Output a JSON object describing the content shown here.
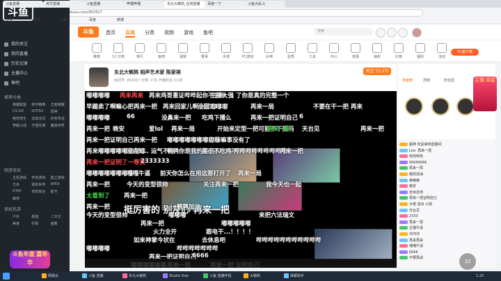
{
  "browser": {
    "tabs": [
      "斗鱼直播",
      "虎牙直播",
      "斗鱼直播",
      "哔哩哔哩",
      "东北大鹌鹑_在线直播",
      "百度一下",
      "斗鱼大乱斗"
    ],
    "url": "https://www.douyu.com/952917",
    "bookmarks": [
      "斗鱼",
      "虎牙",
      "B站",
      "百度",
      "微博"
    ]
  },
  "app": {
    "logo": "斗鱼",
    "nav": [
      "我的关注",
      "我的直播",
      "历史记录",
      "主播中心",
      "鱼吧"
    ],
    "sections": [
      "推荐分类",
      "网游竞技",
      "单机热游"
    ],
    "grid1": [
      "英雄联盟",
      "和平精英",
      "王者荣耀",
      "CS:GO",
      "DOTA2",
      "原神",
      "绝地求生",
      "永劫无间",
      "炉石传说",
      "穿越火线",
      "守望先锋",
      "魔兽世界"
    ],
    "grid2": [
      "主机游戏",
      "怀旧游戏",
      "独立游戏",
      "方舟",
      "我的世界",
      "APEX",
      "GTA5",
      "单机综合",
      "欧卡",
      "森林"
    ],
    "grid3": [
      "户外",
      "颜值",
      "二次元",
      "美食",
      "科技",
      "鱼教"
    ],
    "badge": "斗鱼年度 嘉年华"
  },
  "site": {
    "logo": "斗鱼",
    "nav": [
      "首页",
      "直播",
      "分类",
      "视频",
      "游戏",
      "鱼吧"
    ],
    "search_placeholder": "搜索",
    "cats": [
      "推荐",
      "12 分类",
      "排行",
      "鱼吧",
      "视频",
      "赛事",
      "手游",
      "PC游戏",
      "女神",
      "星秀",
      "工具",
      "中心",
      "竞猜",
      "抽奖",
      "礼物",
      "福利",
      "活动",
      "消息",
      "帮助"
    ],
    "pc_btn": "PC客户端"
  },
  "room": {
    "title": "东北大鹌鹑 相声艺术家 陈家祺",
    "sub": "房间号: 952917    分类: 户外    开播时长 2小时",
    "follow": "关注 72.2万"
  },
  "danmaku": [
    {
      "t": "嘟嘟嘟嘟",
      "c": "white"
    },
    {
      "t": "再来再来",
      "c": "red"
    },
    {
      "t": "再来鸡哥重证哔哔起你不要来",
      "c": "white"
    },
    {
      "t": "主播大强 了你是真的完整一个",
      "c": "white"
    },
    {
      "t": "早踢卖了啊嘛心把",
      "c": "white"
    },
    {
      "t": "再来一把",
      "c": "white"
    },
    {
      "t": "再来回家儿啊小蒙嘟嘟嘟",
      "c": "white"
    },
    {
      "t": "没回2333",
      "c": "white"
    },
    {
      "t": "再来一局",
      "c": "white"
    },
    {
      "t": "不要在干一把 再来",
      "c": "white"
    },
    {
      "t": "嘟嘟嘟嘟",
      "c": "white"
    },
    {
      "t": "66",
      "c": "white"
    },
    {
      "t": "没鼻来一把",
      "c": "white"
    },
    {
      "t": "吃鸡下播么",
      "c": "white"
    },
    {
      "t": "再来一把证明自己",
      "c": "white"
    },
    {
      "t": "6",
      "c": "white"
    },
    {
      "t": "再来一把",
      "c": "white"
    },
    {
      "t": "晚安",
      "c": "white"
    },
    {
      "t": "爱lol",
      "c": "white"
    },
    {
      "t": "再来一局",
      "c": "white"
    },
    {
      "t": "开始来定型一把可能不下播吗",
      "c": "white"
    },
    {
      "t": "再来一把",
      "c": "green"
    },
    {
      "t": "天台见",
      "c": "white"
    },
    {
      "t": "再来一把",
      "c": "white"
    },
    {
      "t": "再来一把证明自己",
      "c": "white"
    },
    {
      "t": "再来一把",
      "c": "white"
    },
    {
      "t": "嘟嘟嘟嘟嘟嘟嘟嘟嘟",
      "c": "white"
    },
    {
      "t": "刀妹嘛事没有了",
      "c": "white"
    },
    {
      "t": "再来嘟嘟嘟嘟嘟嘟嘟嘟",
      "c": "white"
    },
    {
      "t": "没点知.. 运气不好",
      "c": "white"
    },
    {
      "t": "鹌鹑你是我的接班人",
      "c": "white"
    },
    {
      "t": "蒸小不吃鸡不下",
      "c": "white"
    },
    {
      "t": "哔哔哔哔哔哔哔哔哔",
      "c": "white"
    },
    {
      "t": "再来一把",
      "c": "white"
    },
    {
      "t": "再来一把证明了一等奖",
      "c": "red"
    },
    {
      "t": "2333333",
      "c": "white"
    },
    {
      "t": "嘟嘟嘟嘟嘟嘟嘟嘟",
      "c": "white"
    },
    {
      "t": "嘎嘎牛逼",
      "c": "white"
    },
    {
      "t": "前天你怎么在用这那打开了",
      "c": "white"
    },
    {
      "t": "再来一局",
      "c": "white"
    },
    {
      "t": "再来一把",
      "c": "white"
    },
    {
      "t": "今天的变型很帅",
      "c": "white"
    },
    {
      "t": "关注再来一把",
      "c": "white"
    },
    {
      "t": "我今天也一起",
      "c": "white"
    },
    {
      "t": "太看到了",
      "c": "green"
    },
    {
      "t": "再来一把",
      "c": "white"
    },
    {
      "t": "再来一把",
      "c": "white"
    },
    {
      "t": "挺厉害的 别灰心 再来一把",
      "c": "white"
    },
    {
      "t": "鹌鹑加油",
      "c": "white"
    },
    {
      "t": "今天的变型很帅",
      "c": "white"
    },
    {
      "t": "嘟嘟嘟",
      "c": "white"
    },
    {
      "t": "来把六法瑞文",
      "c": "white"
    },
    {
      "t": "再来一把",
      "c": "white"
    },
    {
      "t": "嘟嘟嘟嘟嘟",
      "c": "white"
    },
    {
      "t": "火力全开",
      "c": "white"
    },
    {
      "t": "跟电干...！！！！",
      "c": "white"
    },
    {
      "t": "如来神掌今状在",
      "c": "white"
    },
    {
      "t": "去休息吧",
      "c": "white"
    },
    {
      "t": "哔哔哔哔哔哔哔哔哔哔哔",
      "c": "white"
    },
    {
      "t": "嘟嘟嘟嘟",
      "c": "white"
    },
    {
      "t": "哔哔哔哔哔哔哔",
      "c": "white"
    },
    {
      "t": "再来一把证明自己",
      "c": "white"
    },
    {
      "t": "6666",
      "c": "white"
    },
    {
      "t": "嘟嘟嘟嘟嘟嘟",
      "c": "white"
    },
    {
      "t": "再来一把",
      "c": "white"
    },
    {
      "t": "再来一把 证明自己",
      "c": "white"
    },
    {
      "t": "再来一把",
      "c": "white"
    },
    {
      "t": "不要再战",
      "c": "white"
    }
  ],
  "rank": {
    "tabs": [
      "贡献榜",
      "周榜",
      "粉丝团"
    ],
    "hot_box": "主播 周星"
  },
  "chat": [
    "超神 欢迎来到直播间",
    "Leo: 再来一把",
    "哈哈哈哈",
    "66666666",
    "再来一局",
    "鹌鹑加油",
    "嘟嘟嘟",
    "晚安",
    "去休息吧",
    "再来一把证明自己",
    "大佬 送出 火箭",
    "天台见",
    "2333",
    "再来一把",
    "主播牛逼",
    "冲冲冲",
    "再来再来",
    "嘎嘎牛逼",
    "6666",
    "不要再战"
  ],
  "count_badge": "32",
  "taskbar": {
    "items": [
      "网易云",
      "斗鱼 直播",
      "东北大鹌鹑",
      "Studio One",
      "斗鱼 直播伴侣",
      "大鹌鹑",
      "弹幕助手"
    ],
    "time": "1:25",
    "date": "2022/1/2"
  }
}
